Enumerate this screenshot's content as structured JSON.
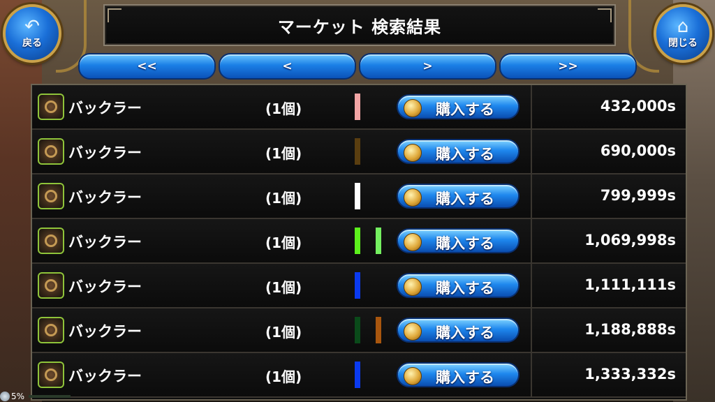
{
  "header": {
    "title": "マーケット 検索結果",
    "back_label": "戻る",
    "close_label": "閉じる"
  },
  "pager": [
    "<<",
    "<",
    ">",
    ">>"
  ],
  "listings": [
    {
      "name": "バックラー",
      "qty": "(1個)",
      "buy_label": "購入する",
      "price": "432,000s",
      "bar_colors": [
        "#f2a5a5"
      ]
    },
    {
      "name": "バックラー",
      "qty": "(1個)",
      "buy_label": "購入する",
      "price": "690,000s",
      "bar_colors": [
        "#5a3e10"
      ]
    },
    {
      "name": "バックラー",
      "qty": "(1個)",
      "buy_label": "購入する",
      "price": "799,999s",
      "bar_colors": [
        "#ffffff"
      ]
    },
    {
      "name": "バックラー",
      "qty": "(1個)",
      "buy_label": "購入する",
      "price": "1,069,998s",
      "bar_colors": [
        "#5cf01c",
        "#74ef60"
      ]
    },
    {
      "name": "バックラー",
      "qty": "(1個)",
      "buy_label": "購入する",
      "price": "1,111,111s",
      "bar_colors": [
        "#0a3af0"
      ]
    },
    {
      "name": "バックラー",
      "qty": "(1個)",
      "buy_label": "購入する",
      "price": "1,188,888s",
      "bar_colors": [
        "#0a4a1a",
        "#a8560e"
      ]
    },
    {
      "name": "バックラー",
      "qty": "(1個)",
      "buy_label": "購入する",
      "price": "1,333,332s",
      "bar_colors": [
        "#0a3af0"
      ]
    }
  ],
  "status": {
    "battery": "5%",
    "battery_level": 0.05
  }
}
